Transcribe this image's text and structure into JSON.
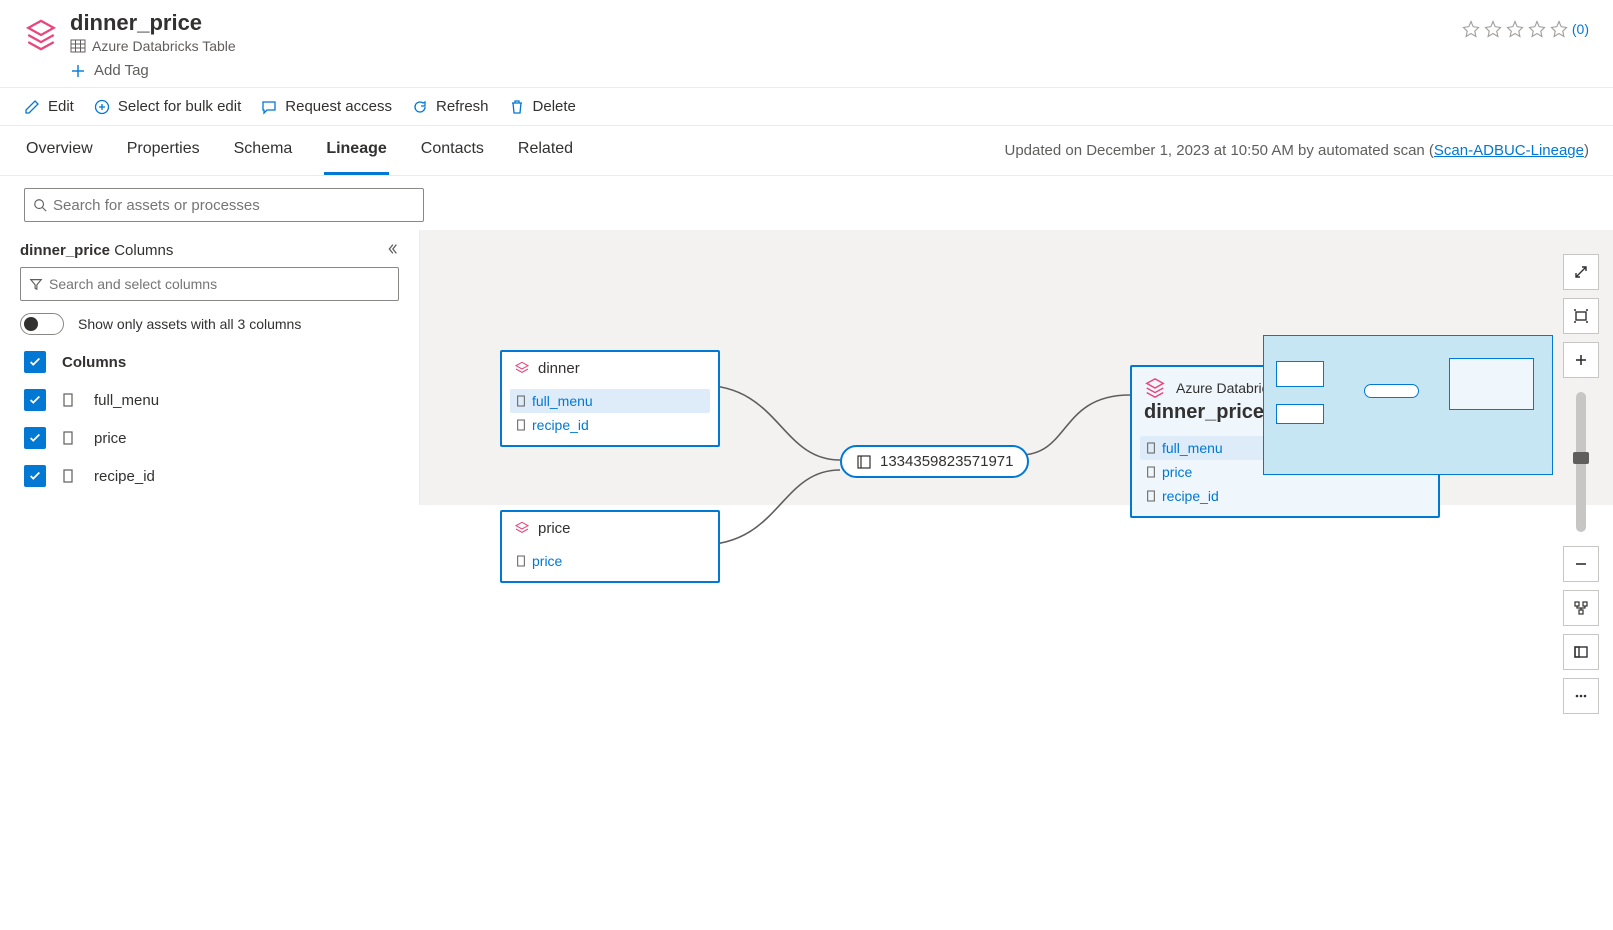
{
  "header": {
    "title": "dinner_price",
    "assetType": "Azure Databricks Table",
    "addTag": "Add Tag",
    "ratingCount": "(0)"
  },
  "toolbar": {
    "edit": "Edit",
    "bulk": "Select for bulk edit",
    "request": "Request access",
    "refresh": "Refresh",
    "delete": "Delete"
  },
  "tabs": {
    "overview": "Overview",
    "properties": "Properties",
    "schema": "Schema",
    "lineage": "Lineage",
    "contacts": "Contacts",
    "related": "Related"
  },
  "updated": {
    "prefix": "Updated on December 1, 2023 at 10:50 AM by automated scan (",
    "link": "Scan-ADBUC-Lineage",
    "suffix": ")"
  },
  "search": {
    "placeholder": "Search for assets or processes"
  },
  "sidebar": {
    "titleStrong": "dinner_price",
    "titleRest": " Columns",
    "colSearch": "Search and select columns",
    "toggleLabel": "Show only assets with all 3 columns",
    "header": "Columns",
    "cols": {
      "c1": "full_menu",
      "c2": "price",
      "c3": "recipe_id"
    }
  },
  "canvas": {
    "dinner": {
      "title": "dinner",
      "c1": "full_menu",
      "c2": "recipe_id"
    },
    "price": {
      "title": "price",
      "c1": "price"
    },
    "process": "1334359823571971",
    "target": {
      "type": "Azure Databricks Table",
      "title": "dinner_price",
      "c1": "full_menu",
      "c2": "price",
      "c3": "recipe_id"
    }
  }
}
